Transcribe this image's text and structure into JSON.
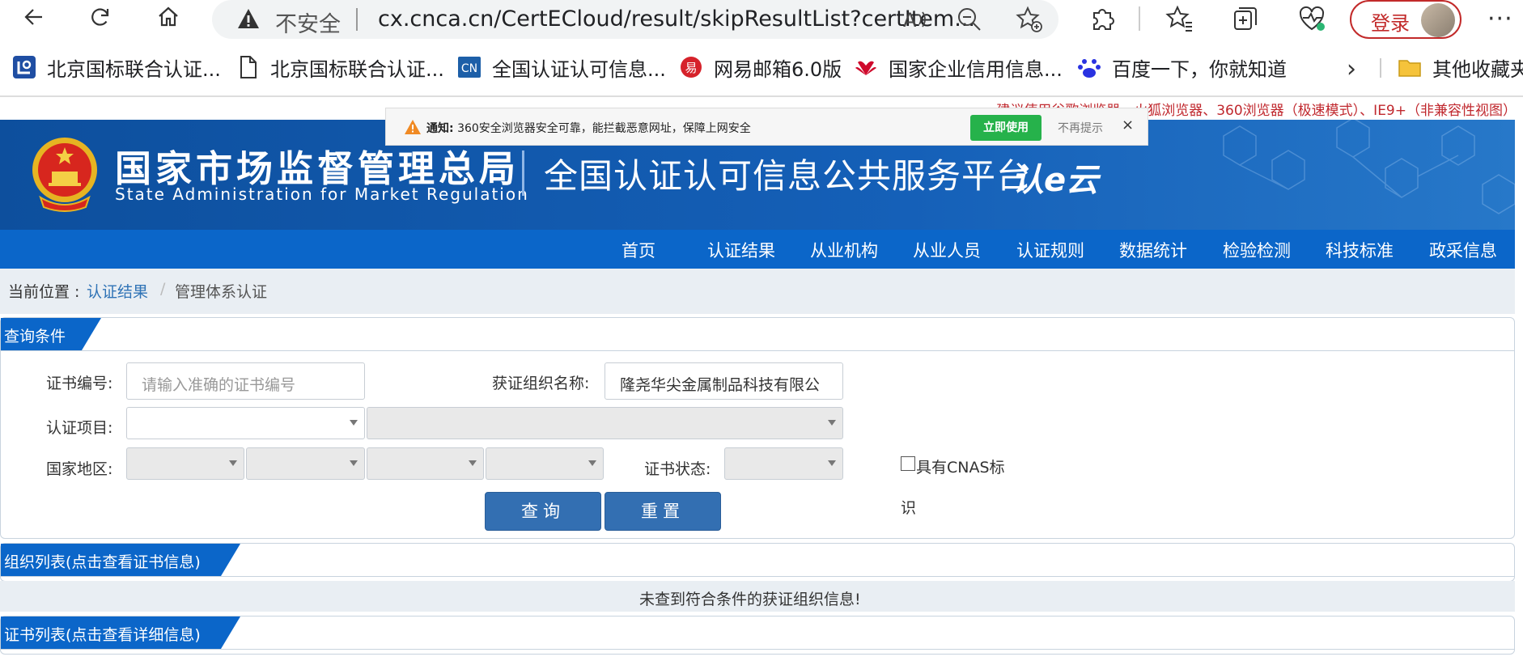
{
  "browser": {
    "insecure_label": "不安全",
    "url": "cx.cnca.cn/CertECloud/result/skipResultList?certItem...",
    "login_label": "登录",
    "icons": [
      "back-icon",
      "refresh-icon",
      "home-icon",
      "warning-icon",
      "read-aloud-icon",
      "zoom-out-icon",
      "add-favorite-icon",
      "extensions-icon",
      "favorites-icon",
      "collections-icon",
      "health-icon",
      "more-icon"
    ]
  },
  "bookmarks": {
    "items": [
      {
        "label": "北京国标联合认证...",
        "icon": "bookmark-site-icon"
      },
      {
        "label": "北京国标联合认证...",
        "icon": "page-icon"
      },
      {
        "label": "全国认证认可信息...",
        "icon": "cnca-icon"
      },
      {
        "label": "网易邮箱6.0版",
        "icon": "netease-icon"
      },
      {
        "label": "国家企业信用信息...",
        "icon": "huawei-icon"
      },
      {
        "label": "百度一下，你就知道",
        "icon": "baidu-icon"
      }
    ],
    "other_folder": "其他收藏夹"
  },
  "notice": {
    "title": "通知:",
    "text": "360安全浏览器安全可靠，能拦截恶意网址，保障上网安全",
    "use_now": "立即使用",
    "dismiss": "不再提示",
    "close": "×"
  },
  "advice": "建议使用谷歌浏览器、火狐浏览器、360浏览器（极速模式）、IE9+（非兼容性视图）",
  "header": {
    "gov_cn": "国家市场监督管理总局",
    "gov_en": "State Administration  for  Market Regulation",
    "platform": "全国认证认可信息公共服务平台",
    "logo_text": "认e云"
  },
  "nav": {
    "items": [
      "首页",
      "认证结果",
      "从业机构",
      "从业人员",
      "认证规则",
      "数据统计",
      "检验检测",
      "科技标准",
      "政采信息"
    ]
  },
  "breadcrumb": {
    "prefix": "当前位置 :",
    "level1": "认证结果",
    "separator": "/",
    "level2": "管理体系认证"
  },
  "query": {
    "section_title": "查询条件",
    "cert_no_label": "证书编号:",
    "cert_no_placeholder": "请输入准确的证书编号",
    "org_name_label": "获证组织名称:",
    "org_name_value": "隆尧华尖金属制品科技有限公",
    "cert_item_label": "认证项目:",
    "region_label": "国家地区:",
    "status_label": "证书状态:",
    "cnas_label": "具有CNAS标",
    "cnas_label_cont": "识",
    "search_button": "查询",
    "reset_button": "重置"
  },
  "org_list": {
    "title": "组织列表(点击查看证书信息)",
    "empty_message": "未查到符合条件的获证组织信息!"
  },
  "cert_list": {
    "title": "证书列表(点击查看详细信息)"
  },
  "colors": {
    "primary": "#0b66c9",
    "button": "#336fb2",
    "advice_red": "#c0282e",
    "login_red": "#c22a2a",
    "notice_green": "#26b24b"
  }
}
